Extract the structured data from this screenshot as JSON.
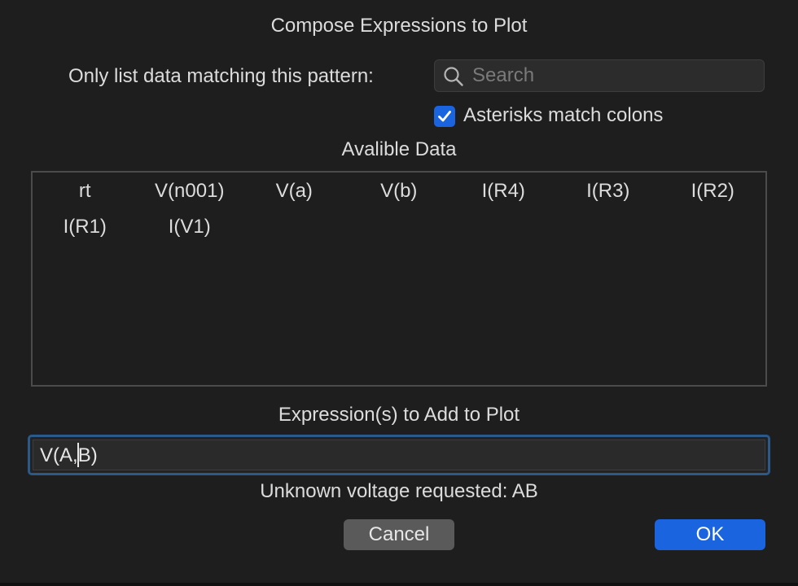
{
  "dialog": {
    "title": "Compose Expressions to Plot"
  },
  "filter": {
    "label": "Only list data matching this pattern:",
    "search_placeholder": "Search",
    "search_value": "",
    "search_icon": "magnifying-glass"
  },
  "asterisks_option": {
    "label": "Asterisks match colons",
    "checked": true
  },
  "available": {
    "title": "Avalible Data",
    "items": [
      "rt",
      "V(n001)",
      "V(a)",
      "V(b)",
      "I(R4)",
      "I(R3)",
      "I(R2)",
      "I(R1)",
      "I(V1)"
    ]
  },
  "expression": {
    "title": "Expression(s) to Add to Plot",
    "value_before_caret": "V(A,",
    "value_after_caret": "B)"
  },
  "status": {
    "message": "Unknown voltage requested: AB"
  },
  "buttons": {
    "cancel": "Cancel",
    "ok": "OK"
  },
  "colors": {
    "background": "#1e1e1e",
    "accent": "#1a64e0",
    "text": "#dcdcdc"
  }
}
